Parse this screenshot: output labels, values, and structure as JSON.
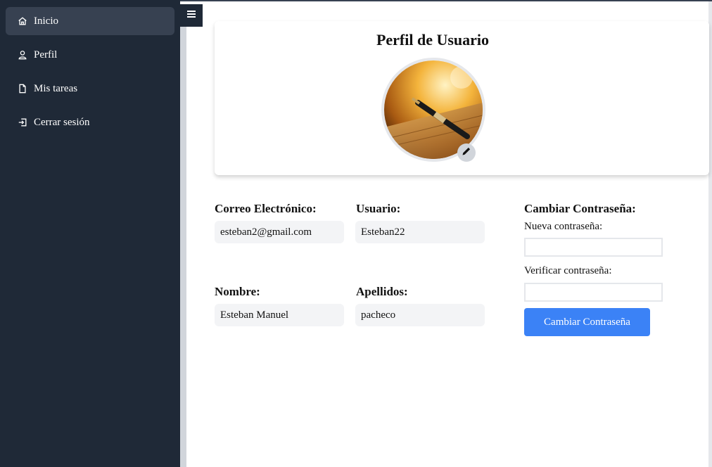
{
  "sidebar": {
    "items": [
      {
        "label": "Inicio",
        "icon": "home-icon",
        "active": true
      },
      {
        "label": "Perfil",
        "icon": "user-icon",
        "active": false
      },
      {
        "label": "Mis tareas",
        "icon": "file-icon",
        "active": false
      },
      {
        "label": "Cerrar sesión",
        "icon": "logout-icon",
        "active": false
      }
    ]
  },
  "toggle": {
    "icon": "hamburger-menu-icon"
  },
  "profile": {
    "title": "Perfil de Usuario",
    "avatar": "fountain-pen-photo",
    "edit_icon": "pencil-icon"
  },
  "fields": {
    "email_label": "Correo Electrónico:",
    "email_value": "esteban2@gmail.com",
    "user_label": "Usuario:",
    "user_value": "Esteban22",
    "name_label": "Nombre:",
    "name_value": "Esteban Manuel",
    "surname_label": "Apellidos:",
    "surname_value": "pacheco"
  },
  "password": {
    "heading": "Cambiar Contraseña:",
    "new_label": "Nueva contraseña:",
    "new_value": "",
    "verify_label": "Verificar contraseña:",
    "verify_value": "",
    "button_label": "Cambiar Contraseña"
  },
  "colors": {
    "sidebar_bg": "#1f2937",
    "active_item": "#374151",
    "accent": "#3b82f6",
    "field_bg": "#f3f4f6"
  }
}
